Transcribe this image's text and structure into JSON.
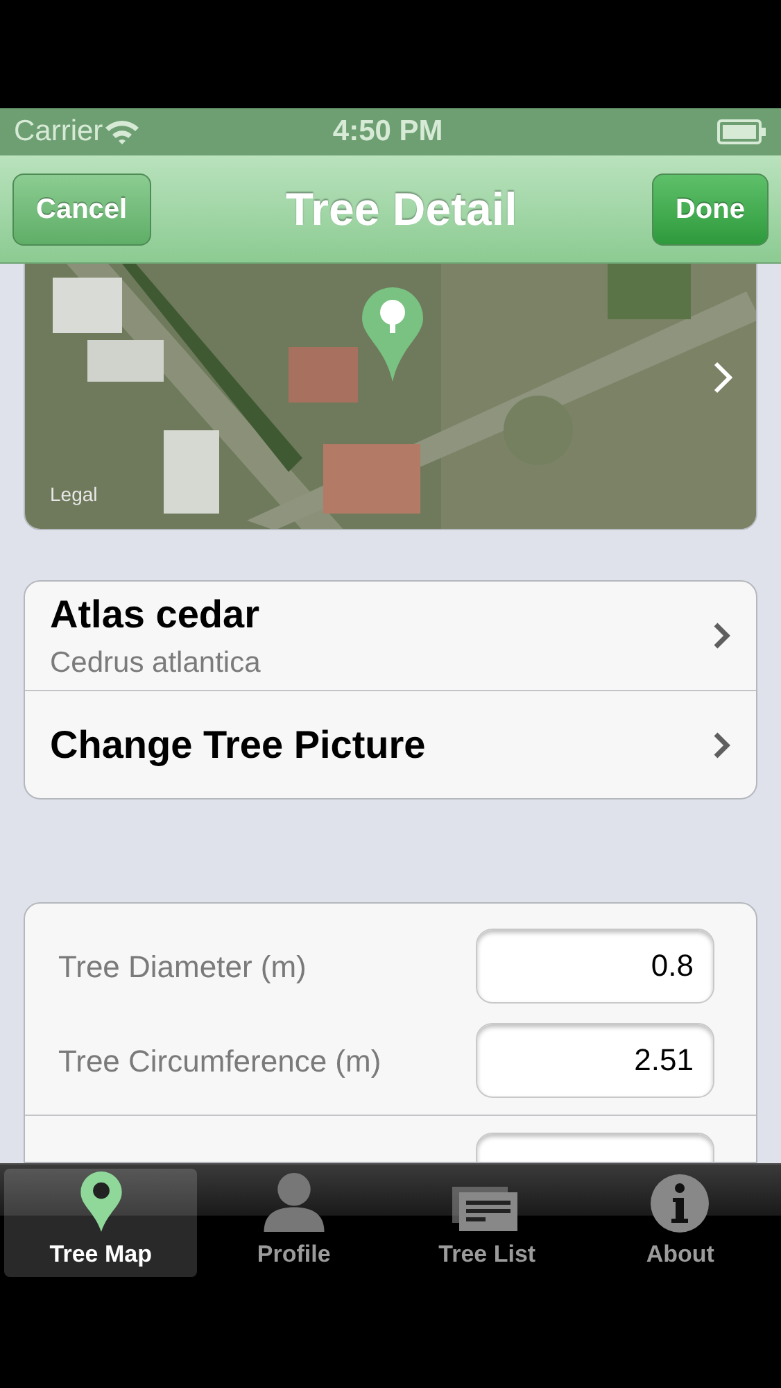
{
  "status_bar": {
    "carrier": "Carrier",
    "time": "4:50 PM"
  },
  "nav_bar": {
    "left_button": "Cancel",
    "title": "Tree Detail",
    "right_button": "Done"
  },
  "map": {
    "legal": "Legal"
  },
  "tree_rows": [
    {
      "title": "Atlas cedar",
      "subtitle": "Cedrus atlantica"
    },
    {
      "title": "Change Tree Picture"
    }
  ],
  "fields": [
    {
      "label": "Tree Diameter (m)",
      "value": "0.8"
    },
    {
      "label": "Tree Circumference (m)",
      "value": "2.51"
    }
  ],
  "tabs": [
    {
      "label": "Tree Map",
      "kind": "pin",
      "selected": true
    },
    {
      "label": "Profile",
      "kind": "person",
      "selected": false
    },
    {
      "label": "Tree List",
      "kind": "list",
      "selected": false
    },
    {
      "label": "About",
      "kind": "info",
      "selected": false
    }
  ]
}
